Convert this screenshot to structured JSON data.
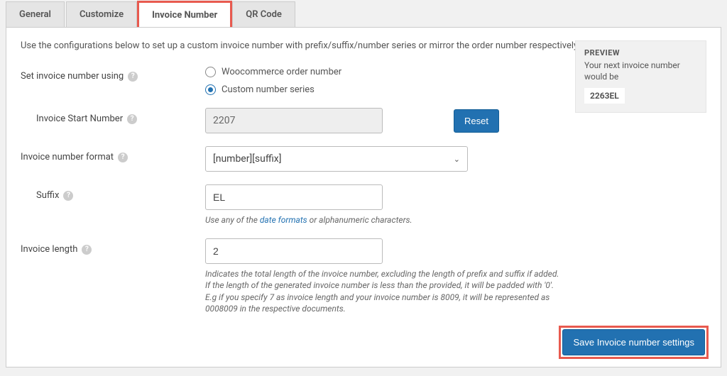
{
  "tabs": {
    "general": "General",
    "customize": "Customize",
    "invoice_number": "Invoice Number",
    "qr_code": "QR Code"
  },
  "intro": "Use the configurations below to set up a custom invoice number with prefix/suffix/number series or mirror the order number respectively.",
  "preview": {
    "title": "PREVIEW",
    "text": "Your next invoice number would be",
    "value": "2263EL"
  },
  "labels": {
    "set_using": "Set invoice number using",
    "start_number": "Invoice Start Number",
    "format": "Invoice number format",
    "suffix": "Suffix",
    "length": "Invoice length"
  },
  "radios": {
    "woo": "Woocommerce order number",
    "custom": "Custom number series"
  },
  "values": {
    "start_number": "2207",
    "format": "[number][suffix]",
    "suffix": "EL",
    "length": "2"
  },
  "buttons": {
    "reset": "Reset",
    "save": "Save Invoice number settings"
  },
  "hints": {
    "suffix_pre": "Use any of the ",
    "suffix_link": "date formats",
    "suffix_post": " or alphanumeric characters.",
    "length": "Indicates the total length of the invoice number, excluding the length of prefix and suffix if added. If the length of the generated invoice number is less than the provided, it will be padded with '0'. E.g if you specify 7 as invoice length and your invoice number is 8009, it will be represented as 0008009 in the respective documents."
  }
}
